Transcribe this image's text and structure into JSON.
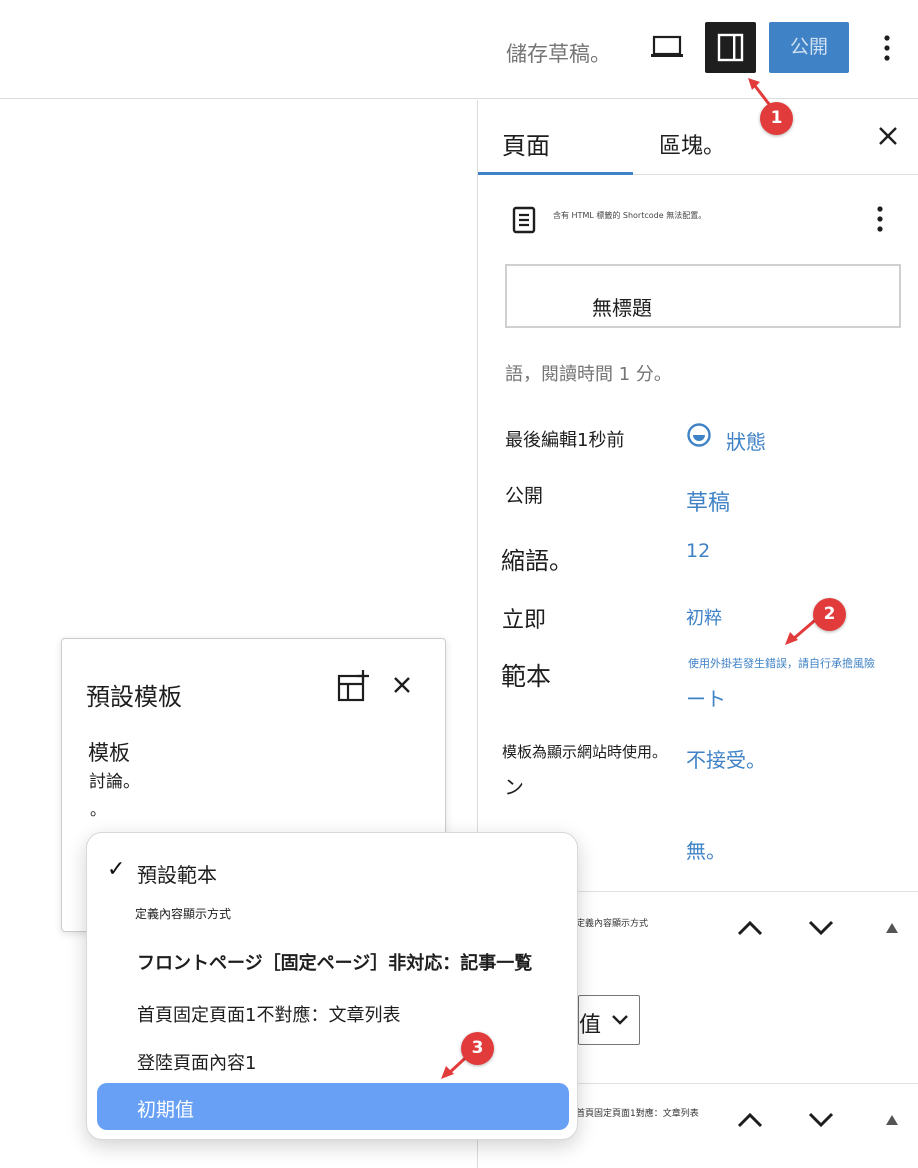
{
  "toolbar": {
    "save_draft": "儲存草稿。",
    "publish": "公開",
    "preview_icon": "laptop-icon",
    "sidebar_icon": "sidebar-toggle-icon",
    "options_icon": "vertical-ellipsis-icon"
  },
  "sidebar": {
    "tab_page": "頁面",
    "tab_block": "區塊。",
    "shortcode_note": "含有 HTML 標籤的 Shortcode 無法配置。",
    "title_placeholder": "無標題",
    "reading_time": "語，閱讀時間 1 分。",
    "rows": [
      {
        "label": "最後編輯1秒前",
        "value": "狀態"
      },
      {
        "label": "公開",
        "value": "草稿"
      },
      {
        "label": "縮語。",
        "value": "12"
      },
      {
        "label": "立即",
        "value": "初粹"
      },
      {
        "label": "範本",
        "value": "使用外掛若發生錯誤，請自行承擔風險",
        "value2": "ート"
      },
      {
        "label": "模板為顯示網站時使用。",
        "label2": "ン",
        "value": "不接受。"
      },
      {
        "label": "",
        "value": "無。"
      }
    ],
    "block1_label": "定義內容顯示方式",
    "block2_label": "首頁固定頁面1對應：文章列表",
    "select_value": "值"
  },
  "popover": {
    "title": "預設模板",
    "label": "模板",
    "desc": "討論。",
    "dot": "。"
  },
  "dropdown": {
    "items": [
      "預設範本",
      "定義內容顯示方式",
      "フロントページ［固定ページ］非対応：記事一覧",
      "首頁固定頁面1不對應：文章列表",
      "登陸頁面內容1",
      "初期值"
    ],
    "selected_index": 5,
    "accent": "#67a0f5"
  },
  "markers": [
    "1",
    "2",
    "3"
  ],
  "colors": {
    "accent": "#3f82c6",
    "marker": "#e23b3b",
    "dark": "#1e1e1e"
  }
}
